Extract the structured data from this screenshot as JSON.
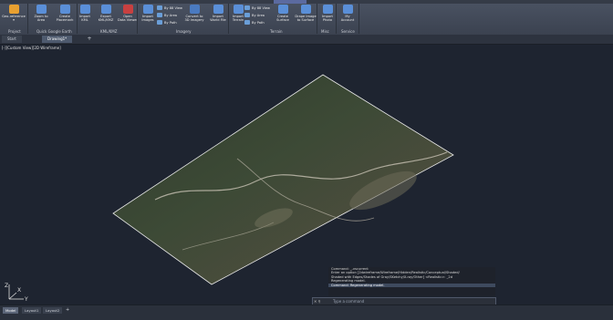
{
  "ribbon": {
    "buttons": [
      {
        "label": "Geo-reference\n▾",
        "icon": "globe-icon",
        "color": "#e8a030"
      },
      {
        "label": "Zoom to\nArea",
        "icon": "zoom-icon",
        "color": "#5a8fd8"
      },
      {
        "label": "Create\nPlacemark",
        "icon": "placemark-icon",
        "color": "#5a8fd8"
      },
      {
        "label": "Import\nKML",
        "icon": "import-kml-icon",
        "color": "#5a8fd8"
      },
      {
        "label": "Export\nKML/KMZ",
        "icon": "export-kml-icon",
        "color": "#5a8fd8"
      },
      {
        "label": "Open\nData Viewer",
        "icon": "data-viewer-icon",
        "color": "#c84040"
      },
      {
        "label": "Import\nImages",
        "icon": "import-images-icon",
        "color": "#5a8fd8"
      },
      {
        "label": "Convert to\n3D Imagery",
        "icon": "convert-3d-icon",
        "color": "#4a7ac0"
      },
      {
        "label": "Import\nWorld File",
        "icon": "world-file-icon",
        "color": "#5a8fd8"
      },
      {
        "label": "Import\nTerrain",
        "icon": "import-terrain-icon",
        "color": "#5a8fd8"
      },
      {
        "label": "Create\nSurface",
        "icon": "create-surface-icon",
        "color": "#5a8fd8"
      },
      {
        "label": "Drape Image\nto Surface",
        "icon": "drape-image-icon",
        "color": "#5a8fd8"
      },
      {
        "label": "Import\nPhoto",
        "icon": "import-photo-icon",
        "color": "#5a8fd8"
      },
      {
        "label": "My\nAccount",
        "icon": "account-icon",
        "color": "#5a8fd8"
      }
    ],
    "imagery_small": [
      "By 88 View",
      "By Area",
      "By Path"
    ],
    "terrain_small": [
      "By 88 View",
      "By Area",
      "By Path"
    ],
    "groups": [
      "Project",
      "Quick Google Earth",
      "KML/KMZ",
      "Imagery",
      "Terrain",
      "Misc",
      "Service"
    ]
  },
  "doc_tabs": [
    "Start",
    "Drawing1*"
  ],
  "view_label": "[-][Custom View][2D Wireframe]",
  "command": {
    "lines": [
      "Command: _-vscurrent",
      "Enter an option [2dwireframe/Wireframe/Hidden/Realistic/Conceptual/Shaded/",
      "Shaded with Edges/Shades of Gray/SKetchy/X-ray/Other] <Realistic>: _2d",
      "Regenerating model.",
      "Command: Regenerating model."
    ],
    "placeholder": "Type a command"
  },
  "layout_tabs": [
    "Model",
    "Layout1",
    "Layout2"
  ],
  "ucs": {
    "x": "X",
    "y": "Y",
    "z": "Z"
  }
}
